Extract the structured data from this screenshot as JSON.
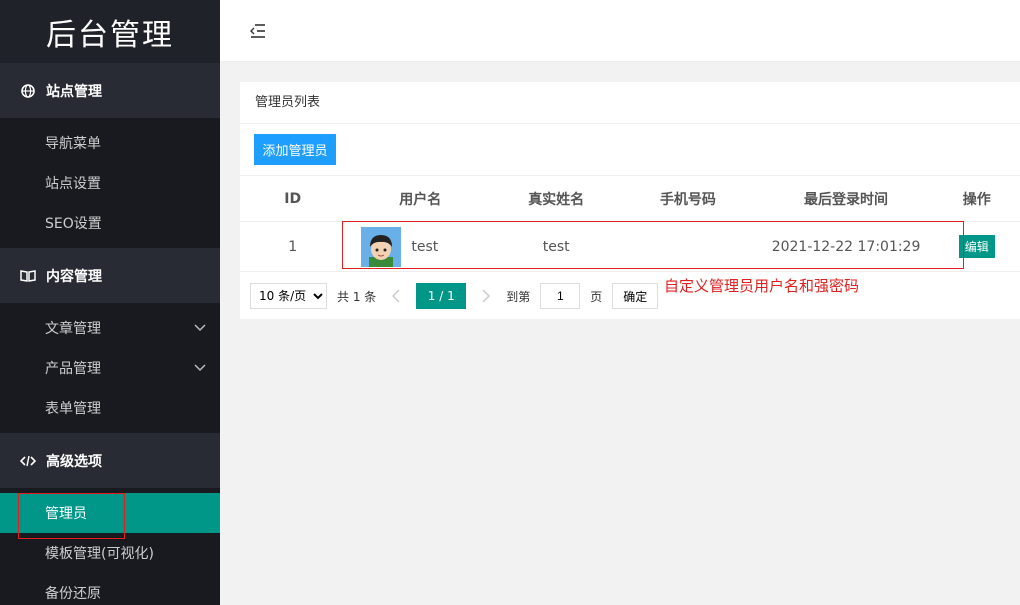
{
  "app": {
    "logo": "后台管理"
  },
  "sidebar": {
    "groups": [
      {
        "title": "站点管理",
        "icon": "globe-icon",
        "items": [
          {
            "label": "导航菜单"
          },
          {
            "label": "站点设置"
          },
          {
            "label": "SEO设置"
          }
        ]
      },
      {
        "title": "内容管理",
        "icon": "book-icon",
        "items": [
          {
            "label": "文章管理",
            "expandable": true
          },
          {
            "label": "产品管理",
            "expandable": true
          },
          {
            "label": "表单管理"
          }
        ]
      },
      {
        "title": "高级选项",
        "icon": "code-icon",
        "items": [
          {
            "label": "管理员",
            "active": true
          },
          {
            "label": "模板管理(可视化)"
          },
          {
            "label": "备份还原"
          }
        ]
      }
    ]
  },
  "header": {
    "fold_icon": "fold-menu-icon"
  },
  "panel": {
    "title": "管理员列表",
    "add_button": "添加管理员",
    "columns": [
      "ID",
      "用户名",
      "真实姓名",
      "手机号码",
      "最后登录时间",
      "操作"
    ],
    "rows": [
      {
        "id": "1",
        "username": "test",
        "realname": "test",
        "phone": "",
        "last_login": "2021-12-22 17:01:29",
        "action": "编辑"
      }
    ]
  },
  "annotation": {
    "text": "自定义管理员用户名和强密码",
    "color": "#e02020"
  },
  "pager": {
    "page_size": "10 条/页",
    "total": "共 1 条",
    "current": "1 / 1",
    "goto_label": "到第",
    "goto_value": "1",
    "page_unit": "页",
    "confirm": "确定"
  },
  "colors": {
    "primary": "#009688",
    "blue": "#1e9fff",
    "sidebar": "#20222a"
  }
}
